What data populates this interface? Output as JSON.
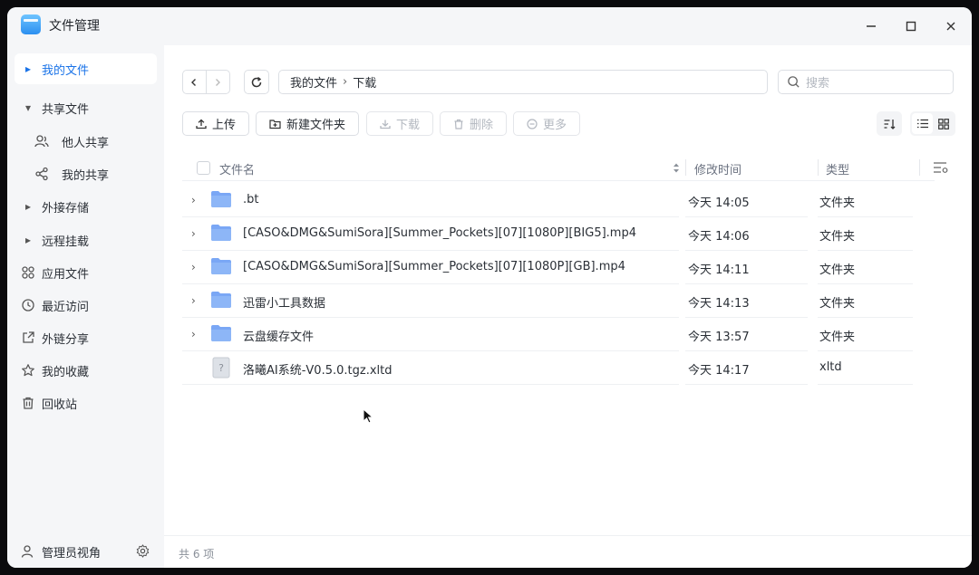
{
  "window": {
    "title": "文件管理"
  },
  "sidebar": {
    "items": [
      {
        "label": "我的文件",
        "lead": "▸"
      },
      {
        "label": "共享文件",
        "lead": "▾"
      },
      {
        "label": "他人共享"
      },
      {
        "label": "我的共享"
      },
      {
        "label": "外接存储",
        "lead": "▸"
      },
      {
        "label": "远程挂载",
        "lead": "▸"
      },
      {
        "label": "应用文件"
      },
      {
        "label": "最近访问"
      },
      {
        "label": "外链分享"
      },
      {
        "label": "我的收藏"
      },
      {
        "label": "回收站"
      }
    ],
    "bottom_label": "管理员视角"
  },
  "toolbar": {
    "path": [
      "我的文件",
      "下载"
    ],
    "path_sep": "›",
    "search_placeholder": "搜索",
    "upload": "上传",
    "new_folder": "新建文件夹",
    "download": "下载",
    "delete": "删除",
    "more": "更多"
  },
  "table": {
    "headers": {
      "name": "文件名",
      "modified": "修改时间",
      "type": "类型"
    },
    "rows": [
      {
        "name": ".bt",
        "modified": "今天 14:05",
        "type": "文件夹",
        "kind": "folder"
      },
      {
        "name": "[CASO&DMG&SumiSora][Summer_Pockets][07][1080P][BIG5].mp4",
        "modified": "今天 14:06",
        "type": "文件夹",
        "kind": "folder"
      },
      {
        "name": "[CASO&DMG&SumiSora][Summer_Pockets][07][1080P][GB].mp4",
        "modified": "今天 14:11",
        "type": "文件夹",
        "kind": "folder"
      },
      {
        "name": "迅雷小工具数据",
        "modified": "今天 14:13",
        "type": "文件夹",
        "kind": "folder"
      },
      {
        "name": "云盘缓存文件",
        "modified": "今天 13:57",
        "type": "文件夹",
        "kind": "folder"
      },
      {
        "name": "洛曦AI系统-V0.5.0.tgz.xltd",
        "modified": "今天 14:17",
        "type": "xltd",
        "kind": "unknown"
      }
    ]
  },
  "footer": {
    "count_text": "共 6 项"
  },
  "colors": {
    "accent": "#1a73e8",
    "folder": "#7aa7f5",
    "sidebar_bg": "#f5f6f8"
  }
}
